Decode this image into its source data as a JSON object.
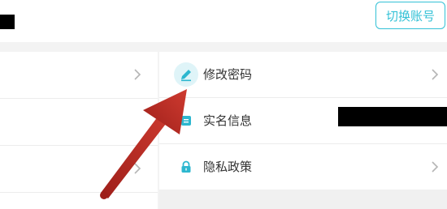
{
  "header": {
    "switch_account_label": "切换账号"
  },
  "settings": {
    "items": [
      {
        "label": "修改密码",
        "icon": "pencil-icon",
        "icon_color": "#2db7cf"
      },
      {
        "label": "实名信息",
        "icon": "id-card-icon",
        "icon_color": "#2db7cf"
      },
      {
        "label": "隐私政策",
        "icon": "lock-icon",
        "icon_color": "#2db7cf"
      }
    ]
  },
  "annotation": {
    "arrow_color": "#c0392b"
  },
  "colors": {
    "accent": "#33c1d6"
  }
}
